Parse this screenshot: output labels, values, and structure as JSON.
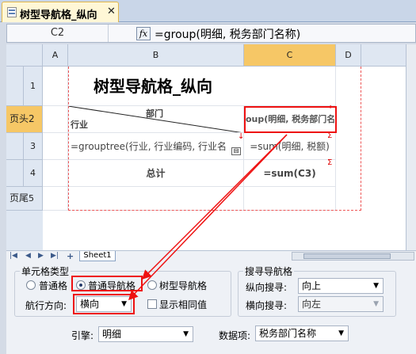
{
  "tab": {
    "title": "树型导航格_纵向",
    "close": "✕"
  },
  "formula_bar": {
    "cell_ref": "C2",
    "fx": "fx",
    "formula": "=group(明细, 税务部门名称)"
  },
  "grid": {
    "columns": [
      "A",
      "B",
      "C",
      "D"
    ],
    "rows": [
      "1",
      "2",
      "3",
      "4",
      "5"
    ],
    "row_labels": {
      "r2": "页头",
      "r5": "页尾"
    },
    "cells": {
      "b1_title": "树型导航格_纵向",
      "b2_top": "部门",
      "b2_bottom": "行业",
      "c2": "oup(明细, 税务部门名",
      "b3": "=grouptree(行业, 行业编码, 行业名",
      "c3": "=sum(明细, 税额)",
      "b4": "总计",
      "c4": "=sum(C3)"
    },
    "sheet_tab": "Sheet1",
    "nav_buttons": [
      "|◀",
      "◀",
      "▶",
      "▶|",
      "+"
    ]
  },
  "panel": {
    "cell_type": {
      "legend": "单元格类型",
      "options": [
        "普通格",
        "普通导航格",
        "树型导航格"
      ],
      "selected": "普通导航格",
      "direction_label": "航行方向:",
      "direction_value": "横向",
      "show_same_label": "显示相同值"
    },
    "search_nav": {
      "legend": "搜寻导航格",
      "vertical_label": "纵向搜寻:",
      "vertical_value": "向上",
      "horizontal_label": "横向搜寻:",
      "horizontal_value": "向左"
    },
    "engine_label": "引擎:",
    "engine_value": "明细",
    "data_item_label": "数据项:",
    "data_item_value": "税务部门名称"
  }
}
